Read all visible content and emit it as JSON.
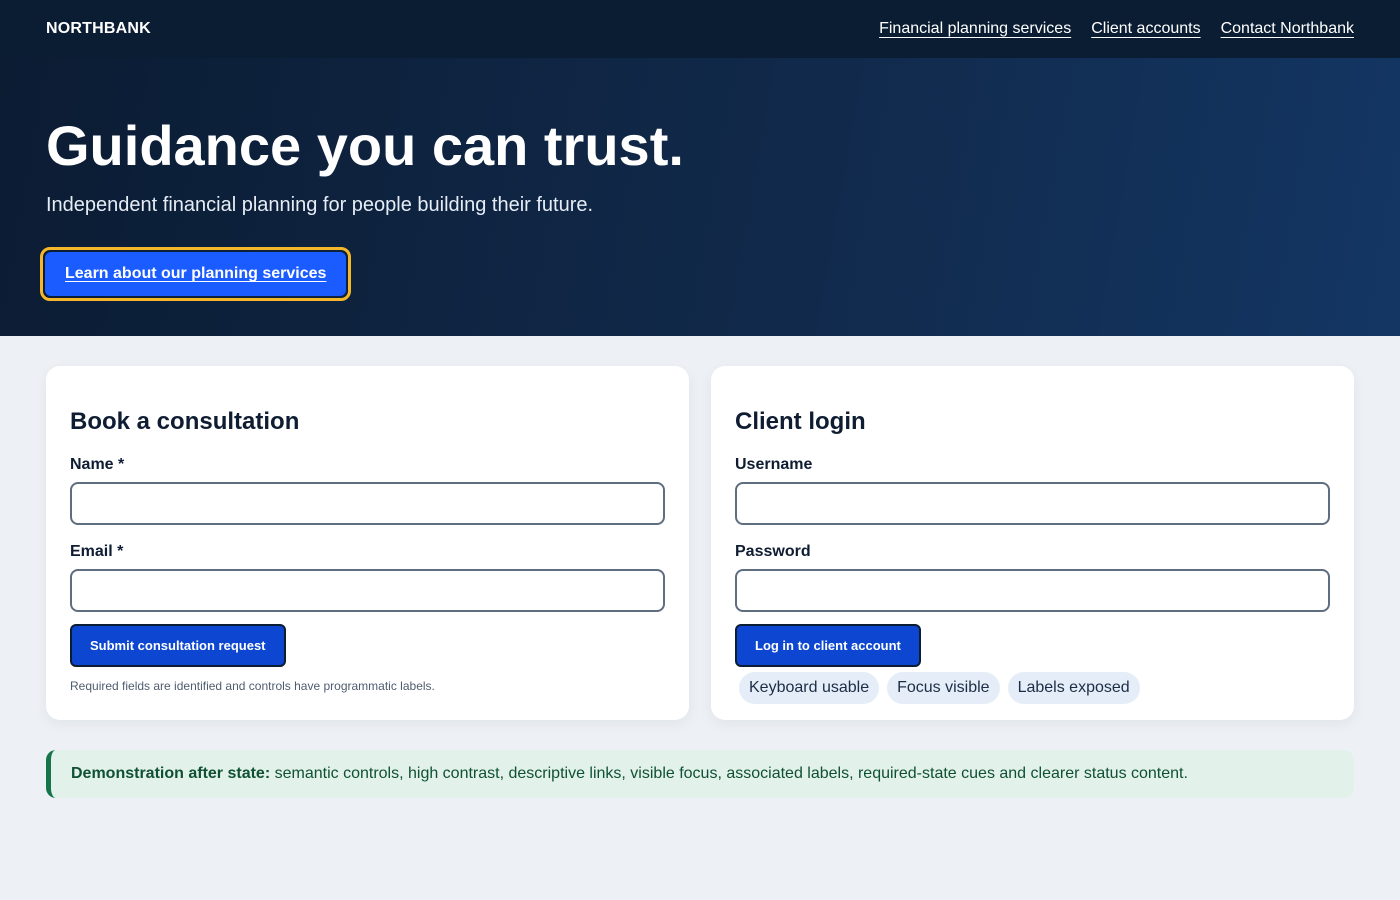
{
  "nav": {
    "brand": "NORTHBANK",
    "links": [
      "Financial planning services",
      "Client accounts",
      "Contact Northbank"
    ]
  },
  "hero": {
    "title": "Guidance you can trust.",
    "subtitle": "Independent financial planning for people building their future.",
    "cta_label": "Learn about our planning services"
  },
  "consultation": {
    "title": "Book a consultation",
    "name_label": "Name *",
    "email_label": "Email *",
    "name_value": "",
    "email_value": "",
    "submit_label": "Submit consultation request",
    "helper": "Required fields are identified and controls have programmatic labels."
  },
  "login": {
    "title": "Client login",
    "username_label": "Username",
    "password_label": "Password",
    "username_value": "",
    "password_value": "",
    "submit_label": "Log in to client account",
    "chips": [
      "Keyboard usable",
      "Focus visible",
      "Labels exposed"
    ]
  },
  "status": {
    "lead": "Demonstration after state:",
    "text": " semantic controls, high contrast, descriptive links, visible focus, associated labels, required-state cues and clearer status content."
  },
  "colors": {
    "nav_bg": "#0b1d33",
    "cta_bg": "#1a5cff",
    "focus_ring": "#f5b72a",
    "button_bg": "#0d47d1",
    "status_accent": "#16744a"
  }
}
